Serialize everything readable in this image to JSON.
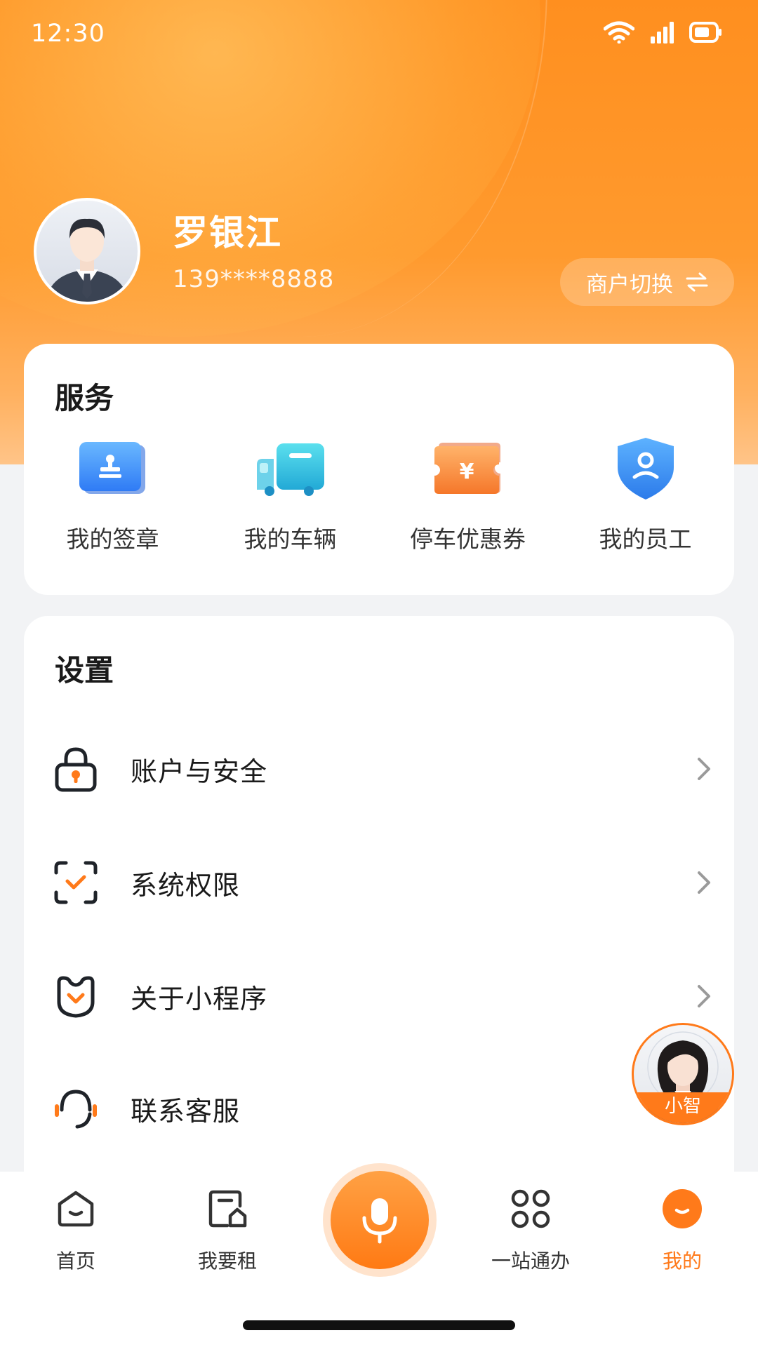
{
  "status_bar": {
    "time": "12:30"
  },
  "profile": {
    "name": "罗银江",
    "phone": "139****8888",
    "switch_label": "商户切换"
  },
  "services": {
    "title": "服务",
    "items": [
      {
        "label": "我的签章",
        "icon": "stamp-icon"
      },
      {
        "label": "我的车辆",
        "icon": "truck-icon"
      },
      {
        "label": "停车优惠券",
        "icon": "coupon-icon"
      },
      {
        "label": "我的员工",
        "icon": "staff-shield-icon"
      }
    ]
  },
  "settings": {
    "title": "设置",
    "items": [
      {
        "label": "账户与安全",
        "icon": "lock-icon"
      },
      {
        "label": "系统权限",
        "icon": "permission-check-icon"
      },
      {
        "label": "关于小程序",
        "icon": "badge-icon"
      },
      {
        "label": "联系客服",
        "icon": "headset-icon"
      }
    ]
  },
  "assistant": {
    "name": "小智"
  },
  "tabbar": {
    "items": [
      {
        "label": "首页",
        "icon": "home-icon"
      },
      {
        "label": "我要租",
        "icon": "rent-icon"
      },
      {
        "label": "",
        "icon": "mic-icon"
      },
      {
        "label": "一站通办",
        "icon": "grid-icon"
      },
      {
        "label": "我的",
        "icon": "profile-icon"
      }
    ],
    "active": "我的"
  },
  "colors": {
    "accent": "#FF7A1A",
    "header_start": "#FF8F1F",
    "header_end": "#FFC488",
    "background": "#F2F3F5"
  }
}
